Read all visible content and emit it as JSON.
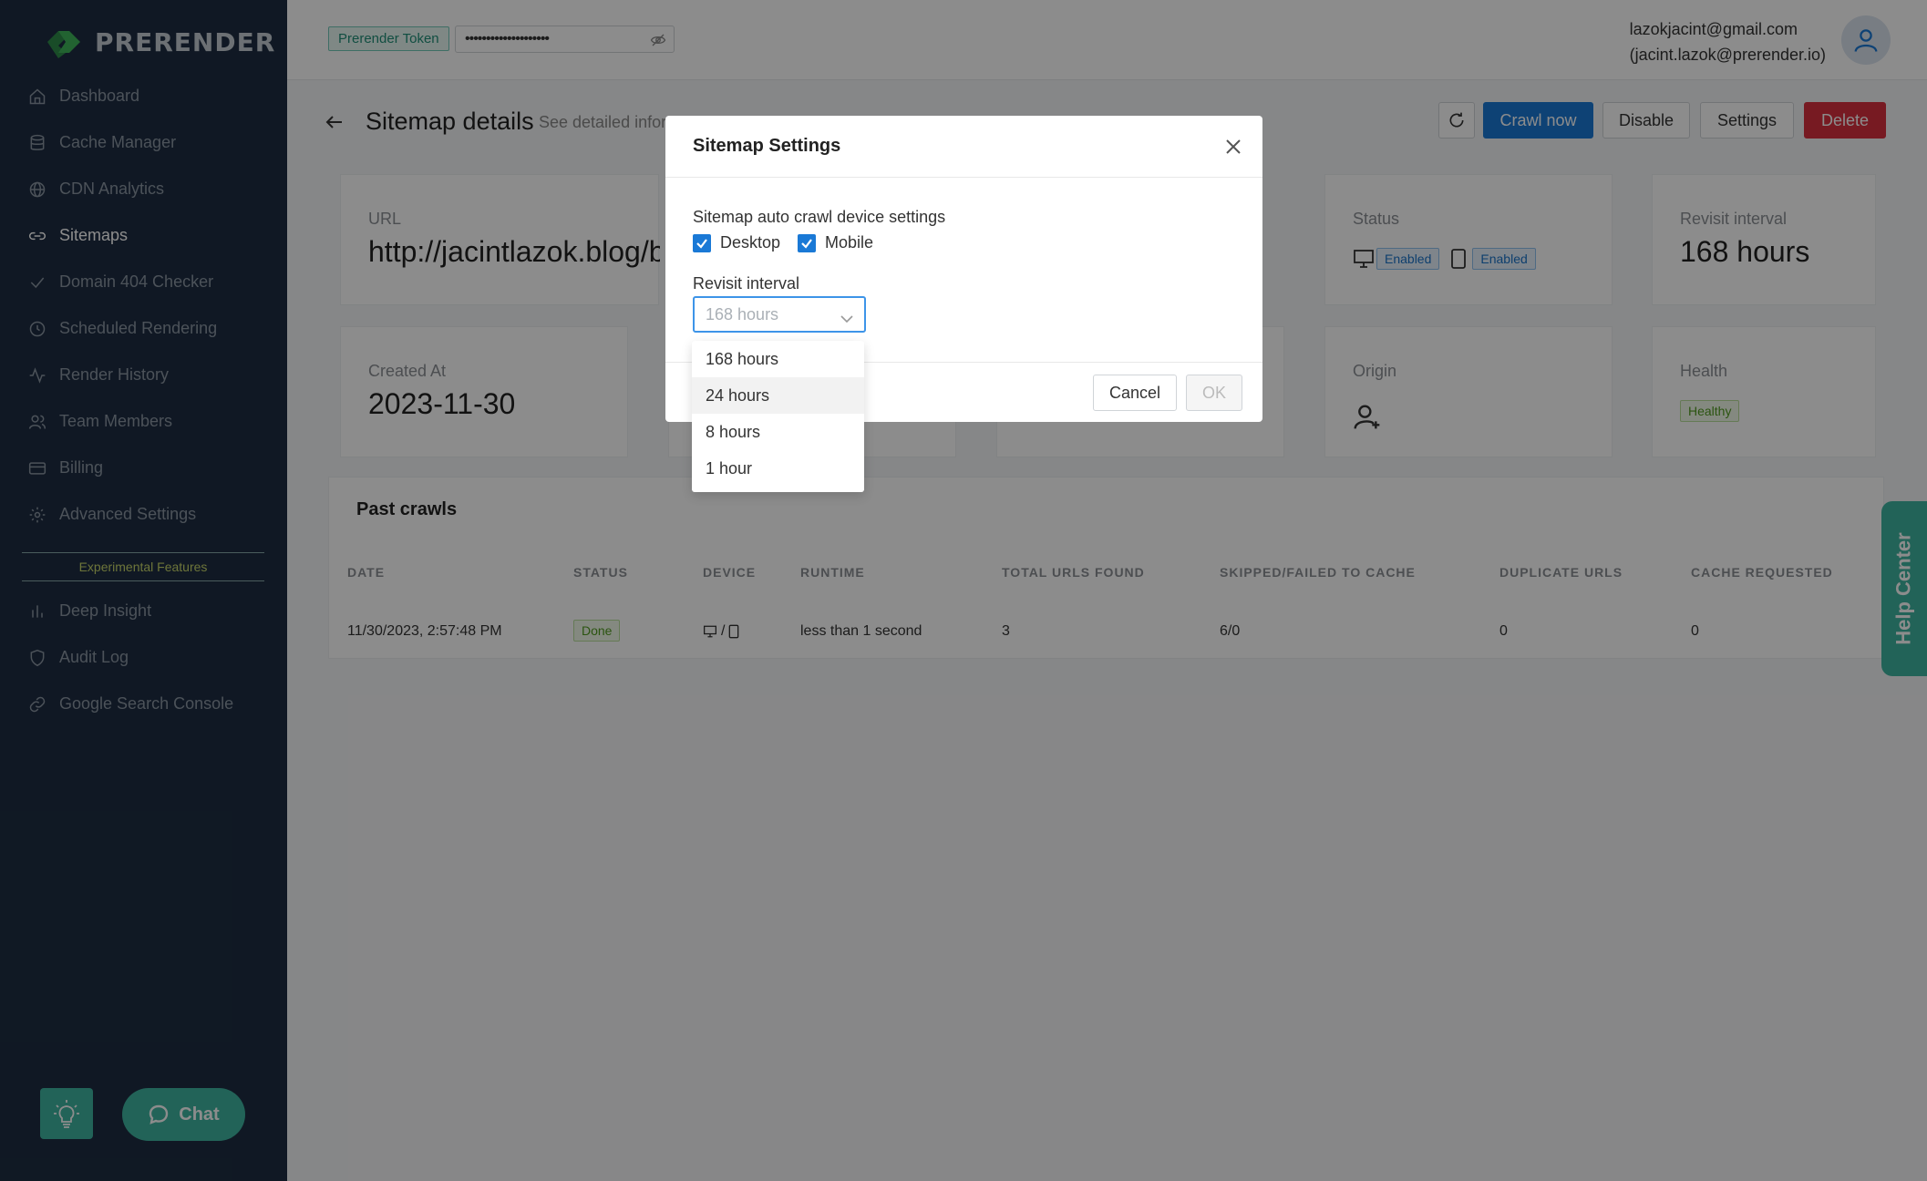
{
  "sidebar": {
    "logo_text": "PRERENDER",
    "items": [
      {
        "label": "Dashboard",
        "icon": "home-icon"
      },
      {
        "label": "Cache Manager",
        "icon": "database-icon"
      },
      {
        "label": "CDN Analytics",
        "icon": "globe-icon"
      },
      {
        "label": "Sitemaps",
        "icon": "link-icon",
        "active": true
      },
      {
        "label": "Domain 404 Checker",
        "icon": "check-icon"
      },
      {
        "label": "Scheduled Rendering",
        "icon": "clock-icon"
      },
      {
        "label": "Render History",
        "icon": "activity-icon"
      },
      {
        "label": "Team Members",
        "icon": "users-icon"
      },
      {
        "label": "Billing",
        "icon": "card-icon"
      },
      {
        "label": "Advanced Settings",
        "icon": "gear-icon"
      }
    ],
    "experimental_label": "Experimental Features",
    "experimental_items": [
      {
        "label": "Deep Insight",
        "icon": "bar-chart-icon"
      },
      {
        "label": "Audit Log",
        "icon": "shield-icon"
      },
      {
        "label": "Google Search Console",
        "icon": "link-icon"
      }
    ],
    "chat_label": "Chat"
  },
  "topbar": {
    "token_label": "Prerender Token",
    "token_value": "••••••••••••••••••••",
    "user_email": "lazokjacint@gmail.com",
    "user_email_secondary": "(jacint.lazok@prerender.io)"
  },
  "page": {
    "title": "Sitemap details",
    "subtitle": "See detailed infor",
    "buttons": {
      "crawl_now": "Crawl now",
      "disable": "Disable",
      "settings": "Settings",
      "delete": "Delete"
    },
    "cards": {
      "url_label": "URL",
      "url_value": "http://jacintlazok.blog/b",
      "status_label": "Status",
      "status_desktop": "Enabled",
      "status_mobile": "Enabled",
      "revisit_label": "Revisit interval",
      "revisit_value": "168 hours",
      "created_label": "Created At",
      "created_value": "2023-11-30",
      "origin_label": "Origin",
      "health_label": "Health",
      "health_value": "Healthy"
    },
    "past_crawls": {
      "title": "Past crawls",
      "columns": [
        "DATE",
        "STATUS",
        "DEVICE",
        "RUNTIME",
        "TOTAL URLS FOUND",
        "SKIPPED/FAILED TO CACHE",
        "DUPLICATE URLS",
        "CACHE REQUESTED"
      ],
      "rows": [
        {
          "date": "11/30/2023, 2:57:48 PM",
          "status": "Done",
          "device_sep": "/",
          "runtime": "less than 1 second",
          "total": "3",
          "skipped": "6/0",
          "duplicate": "0",
          "requested": "0"
        }
      ]
    },
    "help_center": "Help Center"
  },
  "modal": {
    "title": "Sitemap Settings",
    "device_label": "Sitemap auto crawl device settings",
    "desktop_label": "Desktop",
    "mobile_label": "Mobile",
    "desktop_checked": true,
    "mobile_checked": true,
    "revisit_label": "Revisit interval",
    "revisit_selected": "168 hours",
    "options": [
      "168 hours",
      "24 hours",
      "8 hours",
      "1 hour"
    ],
    "cancel": "Cancel",
    "ok": "OK"
  },
  "colors": {
    "sidebar_bg": "#1e2d42",
    "accent_green": "#3fb5a0",
    "primary_blue": "#1a79d6",
    "danger_red": "#d9313e"
  }
}
